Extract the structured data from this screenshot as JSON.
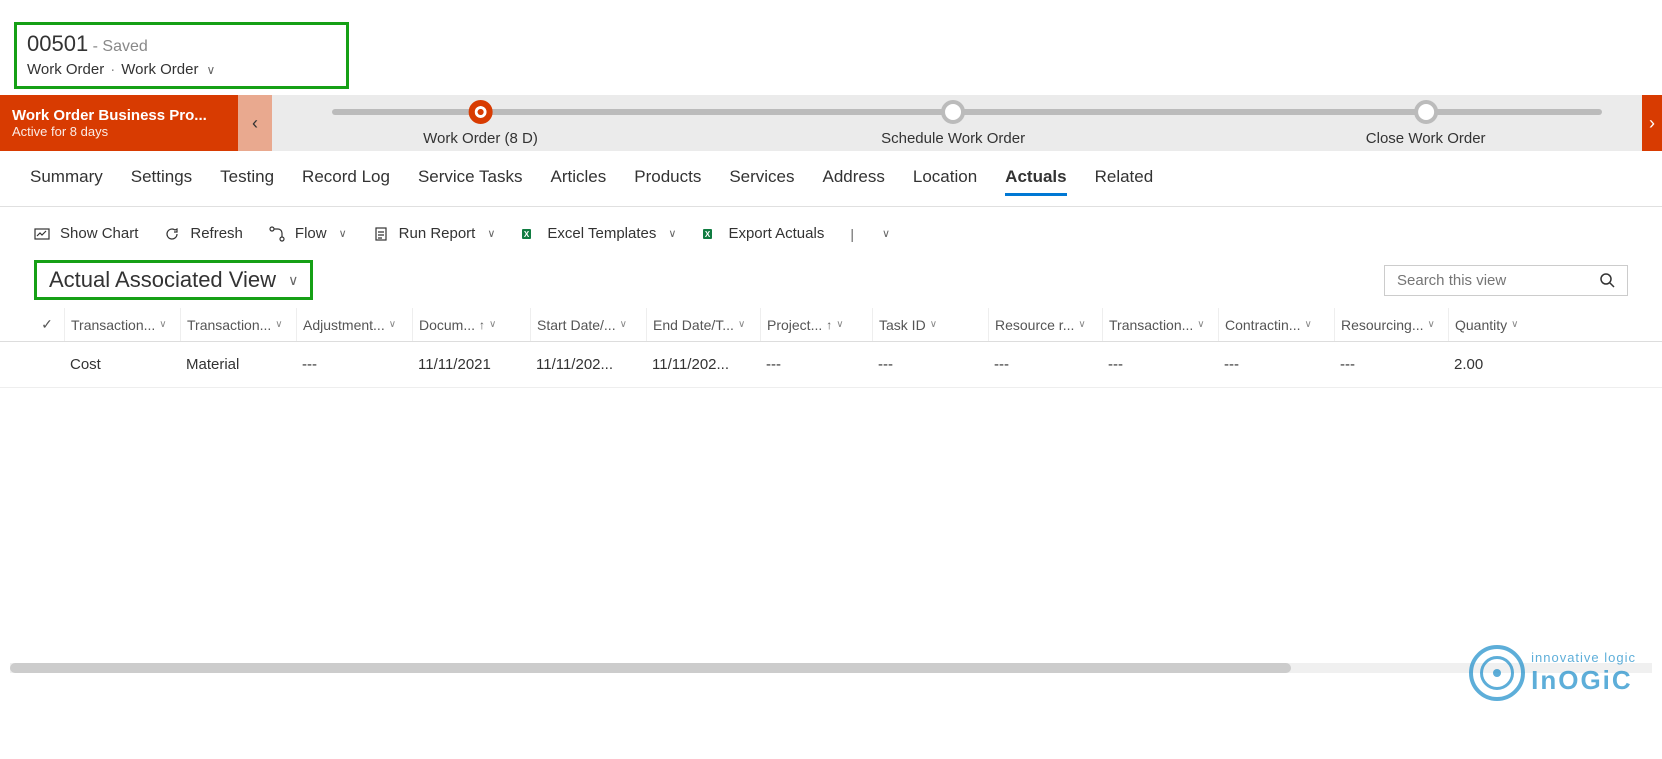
{
  "header": {
    "record_number": "00501",
    "saved_text": "- Saved",
    "entity": "Work Order",
    "form_selector": "Work Order"
  },
  "bpf": {
    "name": "Work Order Business Pro...",
    "status": "Active for 8 days",
    "stages": [
      {
        "label": "Work Order  (8 D)",
        "active": true,
        "pos": 15
      },
      {
        "label": "Schedule Work Order",
        "active": false,
        "pos": 49
      },
      {
        "label": "Close Work Order",
        "active": false,
        "pos": 83
      }
    ]
  },
  "tabs": [
    {
      "label": "Summary"
    },
    {
      "label": "Settings"
    },
    {
      "label": "Testing"
    },
    {
      "label": "Record Log"
    },
    {
      "label": "Service Tasks"
    },
    {
      "label": "Articles"
    },
    {
      "label": "Products"
    },
    {
      "label": "Services"
    },
    {
      "label": "Address"
    },
    {
      "label": "Location"
    },
    {
      "label": "Actuals",
      "active": true
    },
    {
      "label": "Related"
    }
  ],
  "toolbar": {
    "show_chart": "Show Chart",
    "refresh": "Refresh",
    "flow": "Flow",
    "run_report": "Run Report",
    "excel_templates": "Excel Templates",
    "export_actuals": "Export Actuals"
  },
  "view": {
    "name": "Actual Associated View",
    "search_placeholder": "Search this view"
  },
  "columns": [
    {
      "label": "Transaction...",
      "sort": ""
    },
    {
      "label": "Transaction...",
      "sort": ""
    },
    {
      "label": "Adjustment...",
      "sort": ""
    },
    {
      "label": "Docum...",
      "sort": "↑"
    },
    {
      "label": "Start Date/...",
      "sort": ""
    },
    {
      "label": "End Date/T...",
      "sort": ""
    },
    {
      "label": "Project...",
      "sort": "↑"
    },
    {
      "label": "Task ID",
      "sort": ""
    },
    {
      "label": "Resource r...",
      "sort": ""
    },
    {
      "label": "Transaction...",
      "sort": ""
    },
    {
      "label": "Contractin...",
      "sort": ""
    },
    {
      "label": "Resourcing...",
      "sort": ""
    },
    {
      "label": "Quantity",
      "sort": ""
    }
  ],
  "rows": [
    {
      "cells": [
        "Cost",
        "Material",
        "---",
        "11/11/2021",
        "11/11/202...",
        "11/11/202...",
        "---",
        "---",
        "---",
        "---",
        "---",
        "---",
        "2.00"
      ]
    }
  ],
  "logo": {
    "tag": "innovative logic",
    "brand": "InOGiC"
  }
}
